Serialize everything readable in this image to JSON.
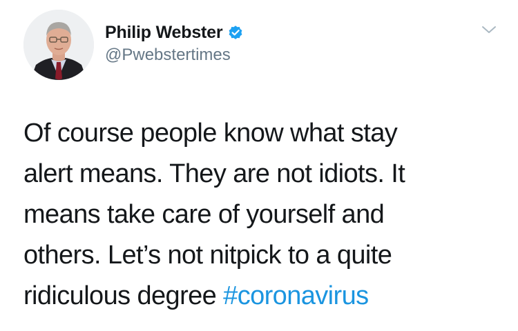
{
  "tweet": {
    "author": {
      "display_name": "Philip Webster",
      "handle": "@Pwebstertimes",
      "verified": true,
      "verified_color": "#1da1f2"
    },
    "menu_icon": "chevron-down-icon",
    "text_lines": [
      "Of course people know what stay",
      "alert means. They are not idiots. It",
      "means take care of yourself and",
      "others. Let’s not nitpick to a quite",
      "ridiculous degree "
    ],
    "hashtag": "#coronavirus",
    "hashtag_color": "#1b95e0"
  }
}
